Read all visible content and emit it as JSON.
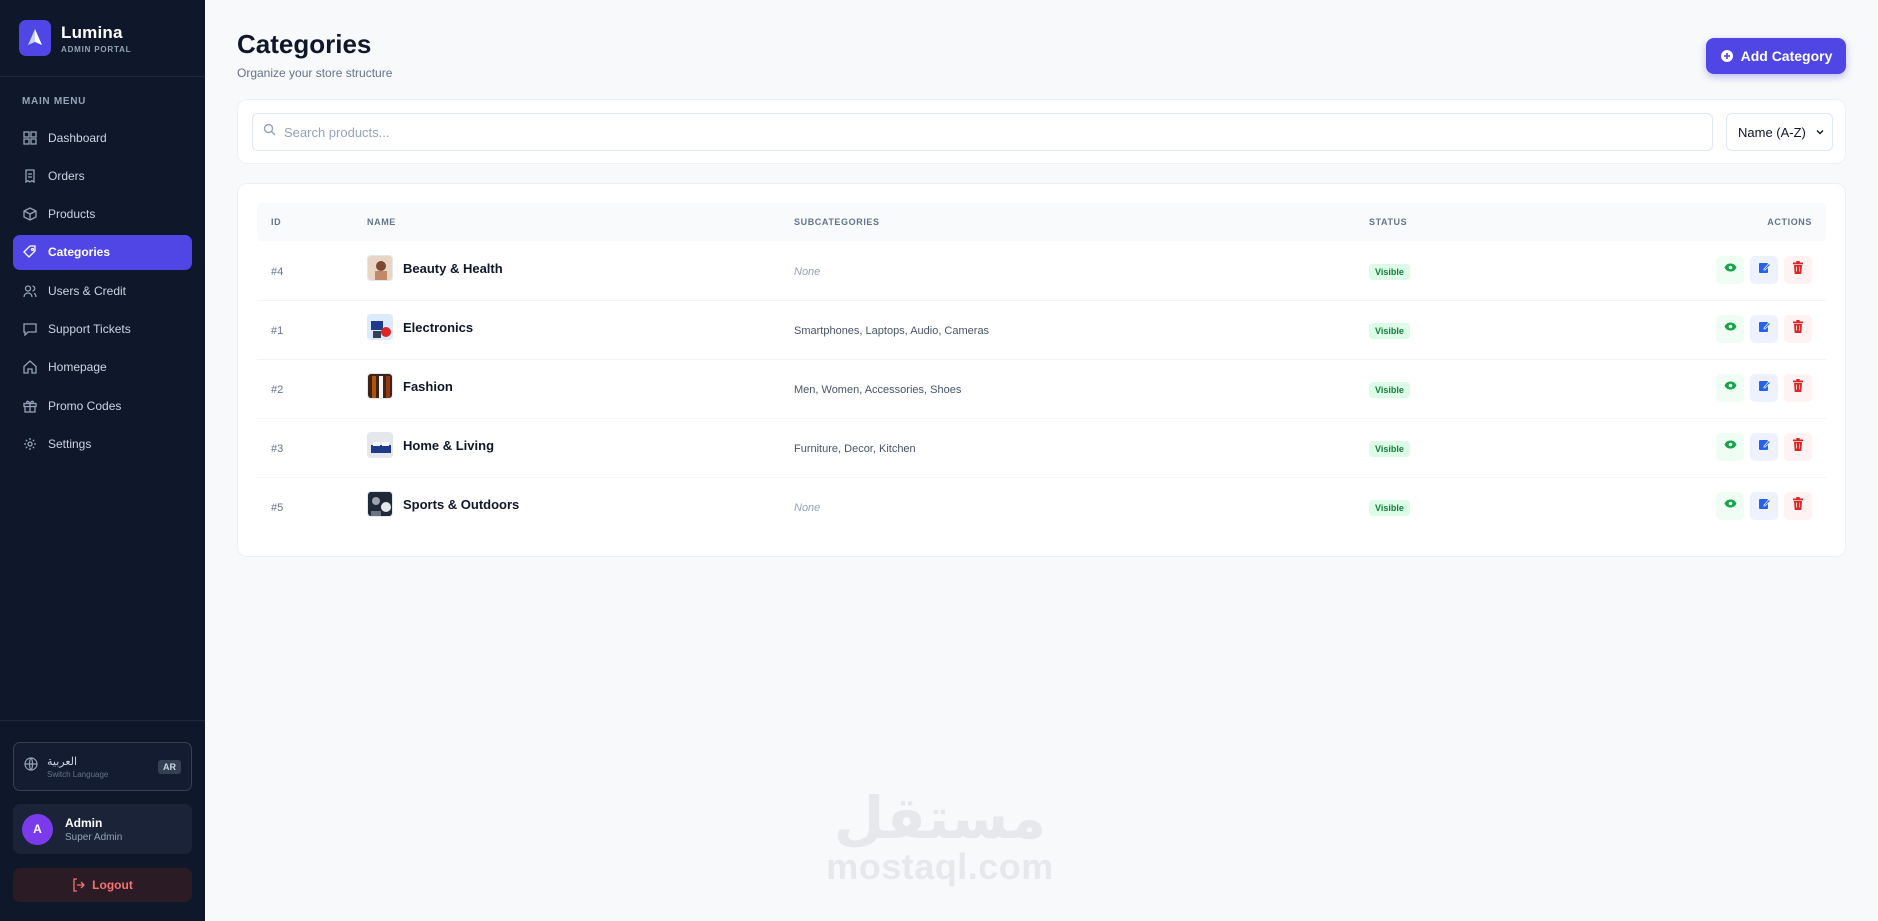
{
  "brand": {
    "name": "Lumina",
    "subtitle": "ADMIN PORTAL"
  },
  "sidebar": {
    "menu_title": "MAIN MENU",
    "items": [
      {
        "label": "Dashboard",
        "icon": "dashboard-icon"
      },
      {
        "label": "Orders",
        "icon": "receipt-icon"
      },
      {
        "label": "Products",
        "icon": "box-icon"
      },
      {
        "label": "Categories",
        "icon": "tag-icon",
        "active": true
      },
      {
        "label": "Users & Credit",
        "icon": "users-icon"
      },
      {
        "label": "Support Tickets",
        "icon": "chat-icon"
      },
      {
        "label": "Homepage",
        "icon": "home-icon"
      },
      {
        "label": "Promo Codes",
        "icon": "gift-icon"
      },
      {
        "label": "Settings",
        "icon": "gear-icon"
      }
    ],
    "language": {
      "label": "العربية",
      "sub": "Switch Language",
      "badge": "AR"
    },
    "user": {
      "initial": "A",
      "name": "Admin",
      "role": "Super Admin"
    },
    "logout_label": "Logout"
  },
  "header": {
    "title": "Categories",
    "subtitle": "Organize your store structure",
    "add_button_label": "Add Category"
  },
  "filters": {
    "search_placeholder": "Search products...",
    "sort_value": "Name (A-Z)"
  },
  "table": {
    "columns": [
      "ID",
      "NAME",
      "SUBCATEGORIES",
      "STATUS",
      "ACTIONS"
    ],
    "rows": [
      {
        "id": "#4",
        "name": "Beauty & Health",
        "subcategories": "None",
        "status": "Visible"
      },
      {
        "id": "#1",
        "name": "Electronics",
        "subcategories": "Smartphones, Laptops, Audio, Cameras",
        "status": "Visible"
      },
      {
        "id": "#2",
        "name": "Fashion",
        "subcategories": "Men, Women, Accessories, Shoes",
        "status": "Visible"
      },
      {
        "id": "#3",
        "name": "Home & Living",
        "subcategories": "Furniture, Decor, Kitchen",
        "status": "Visible"
      },
      {
        "id": "#5",
        "name": "Sports & Outdoors",
        "subcategories": "None",
        "status": "Visible"
      }
    ]
  },
  "watermark": {
    "arabic": "مستقل",
    "latin": "mostaql.com"
  },
  "colors": {
    "accent": "#4f46e5",
    "sidebar_bg": "#0f172a",
    "status_green": "#15803d",
    "danger": "#dc2626"
  }
}
